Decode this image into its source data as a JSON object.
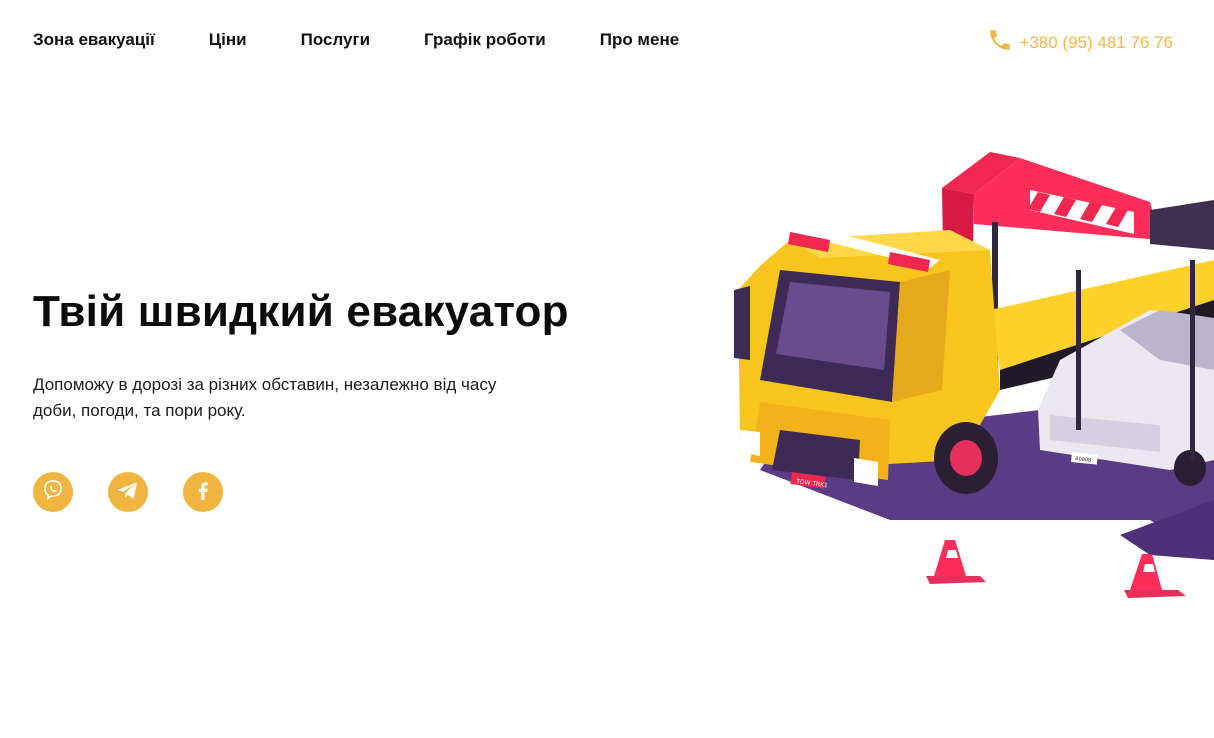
{
  "nav": {
    "items": [
      {
        "label": "Зона евакуації"
      },
      {
        "label": "Ціни"
      },
      {
        "label": "Послуги"
      },
      {
        "label": "Графік роботи"
      },
      {
        "label": "Про мене"
      }
    ]
  },
  "contact": {
    "phone": "+380 (95) 481 76 76",
    "icon": "phone-icon",
    "color": "#f0b74a"
  },
  "hero": {
    "title": "Твій швидкий евакуатор",
    "text": "Допоможу в дорозі за різних обставин, незалежно від часу доби, погоди, та пори року."
  },
  "socials": [
    {
      "icon": "viber-icon"
    },
    {
      "icon": "telegram-icon"
    },
    {
      "icon": "facebook-icon"
    }
  ],
  "illustration": {
    "truck_plate": "TOW TRK1",
    "car_plate": "A0808"
  },
  "colors": {
    "accent": "#f0b440",
    "truck_yellow": "#f8c51f",
    "crane_red": "#f0284f",
    "shadow_purple": "#5b3a86"
  }
}
